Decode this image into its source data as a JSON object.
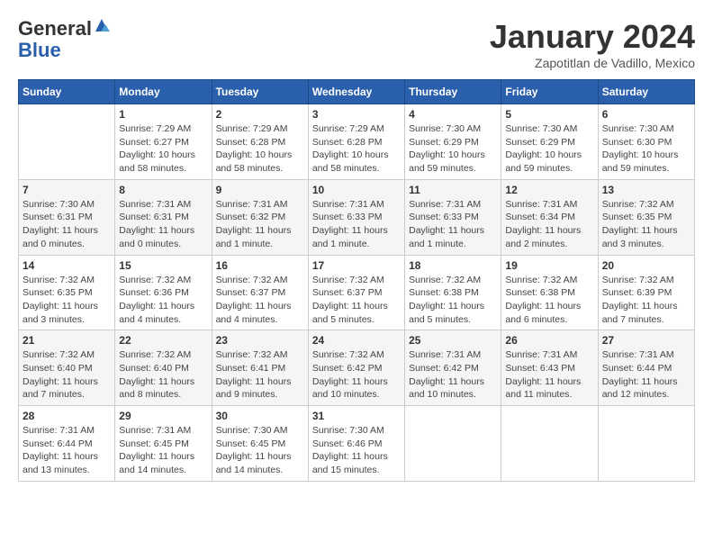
{
  "header": {
    "logo_general": "General",
    "logo_blue": "Blue",
    "month_title": "January 2024",
    "subtitle": "Zapotitlan de Vadillo, Mexico"
  },
  "columns": [
    "Sunday",
    "Monday",
    "Tuesday",
    "Wednesday",
    "Thursday",
    "Friday",
    "Saturday"
  ],
  "weeks": [
    [
      {
        "day": "",
        "info": ""
      },
      {
        "day": "1",
        "info": "Sunrise: 7:29 AM\nSunset: 6:27 PM\nDaylight: 10 hours\nand 58 minutes."
      },
      {
        "day": "2",
        "info": "Sunrise: 7:29 AM\nSunset: 6:28 PM\nDaylight: 10 hours\nand 58 minutes."
      },
      {
        "day": "3",
        "info": "Sunrise: 7:29 AM\nSunset: 6:28 PM\nDaylight: 10 hours\nand 58 minutes."
      },
      {
        "day": "4",
        "info": "Sunrise: 7:30 AM\nSunset: 6:29 PM\nDaylight: 10 hours\nand 59 minutes."
      },
      {
        "day": "5",
        "info": "Sunrise: 7:30 AM\nSunset: 6:29 PM\nDaylight: 10 hours\nand 59 minutes."
      },
      {
        "day": "6",
        "info": "Sunrise: 7:30 AM\nSunset: 6:30 PM\nDaylight: 10 hours\nand 59 minutes."
      }
    ],
    [
      {
        "day": "7",
        "info": "Sunrise: 7:30 AM\nSunset: 6:31 PM\nDaylight: 11 hours\nand 0 minutes."
      },
      {
        "day": "8",
        "info": "Sunrise: 7:31 AM\nSunset: 6:31 PM\nDaylight: 11 hours\nand 0 minutes."
      },
      {
        "day": "9",
        "info": "Sunrise: 7:31 AM\nSunset: 6:32 PM\nDaylight: 11 hours\nand 1 minute."
      },
      {
        "day": "10",
        "info": "Sunrise: 7:31 AM\nSunset: 6:33 PM\nDaylight: 11 hours\nand 1 minute."
      },
      {
        "day": "11",
        "info": "Sunrise: 7:31 AM\nSunset: 6:33 PM\nDaylight: 11 hours\nand 1 minute."
      },
      {
        "day": "12",
        "info": "Sunrise: 7:31 AM\nSunset: 6:34 PM\nDaylight: 11 hours\nand 2 minutes."
      },
      {
        "day": "13",
        "info": "Sunrise: 7:32 AM\nSunset: 6:35 PM\nDaylight: 11 hours\nand 3 minutes."
      }
    ],
    [
      {
        "day": "14",
        "info": "Sunrise: 7:32 AM\nSunset: 6:35 PM\nDaylight: 11 hours\nand 3 minutes."
      },
      {
        "day": "15",
        "info": "Sunrise: 7:32 AM\nSunset: 6:36 PM\nDaylight: 11 hours\nand 4 minutes."
      },
      {
        "day": "16",
        "info": "Sunrise: 7:32 AM\nSunset: 6:37 PM\nDaylight: 11 hours\nand 4 minutes."
      },
      {
        "day": "17",
        "info": "Sunrise: 7:32 AM\nSunset: 6:37 PM\nDaylight: 11 hours\nand 5 minutes."
      },
      {
        "day": "18",
        "info": "Sunrise: 7:32 AM\nSunset: 6:38 PM\nDaylight: 11 hours\nand 5 minutes."
      },
      {
        "day": "19",
        "info": "Sunrise: 7:32 AM\nSunset: 6:38 PM\nDaylight: 11 hours\nand 6 minutes."
      },
      {
        "day": "20",
        "info": "Sunrise: 7:32 AM\nSunset: 6:39 PM\nDaylight: 11 hours\nand 7 minutes."
      }
    ],
    [
      {
        "day": "21",
        "info": "Sunrise: 7:32 AM\nSunset: 6:40 PM\nDaylight: 11 hours\nand 7 minutes."
      },
      {
        "day": "22",
        "info": "Sunrise: 7:32 AM\nSunset: 6:40 PM\nDaylight: 11 hours\nand 8 minutes."
      },
      {
        "day": "23",
        "info": "Sunrise: 7:32 AM\nSunset: 6:41 PM\nDaylight: 11 hours\nand 9 minutes."
      },
      {
        "day": "24",
        "info": "Sunrise: 7:32 AM\nSunset: 6:42 PM\nDaylight: 11 hours\nand 10 minutes."
      },
      {
        "day": "25",
        "info": "Sunrise: 7:31 AM\nSunset: 6:42 PM\nDaylight: 11 hours\nand 10 minutes."
      },
      {
        "day": "26",
        "info": "Sunrise: 7:31 AM\nSunset: 6:43 PM\nDaylight: 11 hours\nand 11 minutes."
      },
      {
        "day": "27",
        "info": "Sunrise: 7:31 AM\nSunset: 6:44 PM\nDaylight: 11 hours\nand 12 minutes."
      }
    ],
    [
      {
        "day": "28",
        "info": "Sunrise: 7:31 AM\nSunset: 6:44 PM\nDaylight: 11 hours\nand 13 minutes."
      },
      {
        "day": "29",
        "info": "Sunrise: 7:31 AM\nSunset: 6:45 PM\nDaylight: 11 hours\nand 14 minutes."
      },
      {
        "day": "30",
        "info": "Sunrise: 7:30 AM\nSunset: 6:45 PM\nDaylight: 11 hours\nand 14 minutes."
      },
      {
        "day": "31",
        "info": "Sunrise: 7:30 AM\nSunset: 6:46 PM\nDaylight: 11 hours\nand 15 minutes."
      },
      {
        "day": "",
        "info": ""
      },
      {
        "day": "",
        "info": ""
      },
      {
        "day": "",
        "info": ""
      }
    ]
  ]
}
